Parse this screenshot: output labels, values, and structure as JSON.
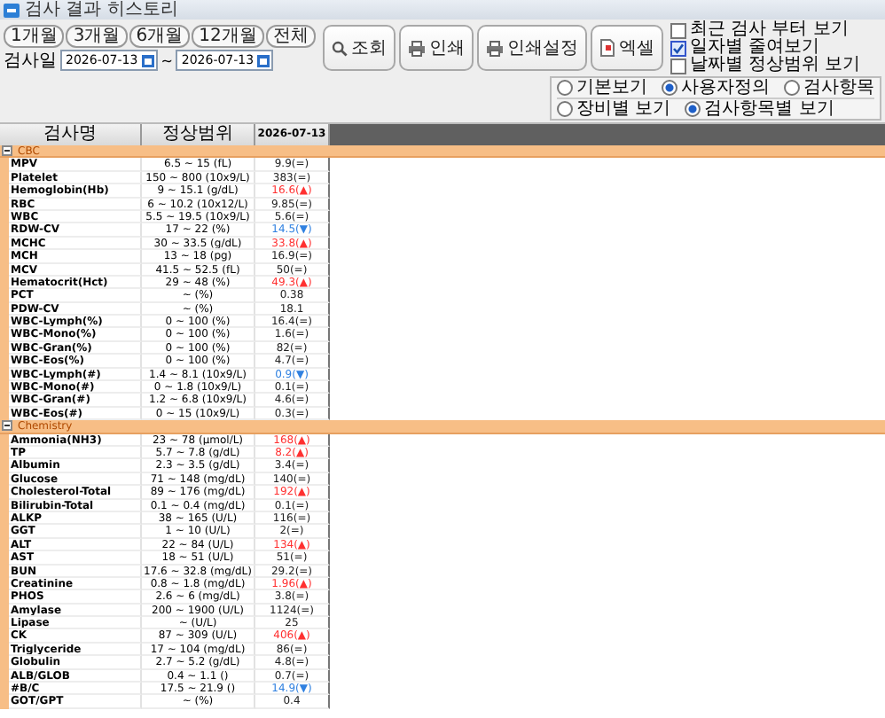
{
  "window": {
    "title": "검사 결과 히스토리"
  },
  "periods": [
    "1개월",
    "3개월",
    "6개월",
    "12개월",
    "전체"
  ],
  "date_filter": {
    "label": "검사일",
    "from": "2026-07-13",
    "separator": "~",
    "to": "2026-07-13"
  },
  "actions": [
    {
      "kind": "search",
      "label": "조회"
    },
    {
      "kind": "print",
      "label": "인쇄"
    },
    {
      "kind": "print",
      "label": "인쇄설정"
    },
    {
      "kind": "excel",
      "label": "엑셀"
    }
  ],
  "options": [
    {
      "label": "최근 검사 부터 보기",
      "checked": false
    },
    {
      "label": "일자별 줄여보기",
      "checked": true
    },
    {
      "label": "날짜별 정상범위 보기",
      "checked": false
    }
  ],
  "view_modes": [
    [
      {
        "label": "기본보기",
        "selected": false
      },
      {
        "label": "사용자정의",
        "selected": true
      },
      {
        "label": "검사항목",
        "selected": false
      }
    ],
    [
      {
        "label": "장비별 보기",
        "selected": false
      },
      {
        "label": "검사항목별 보기",
        "selected": true
      }
    ]
  ],
  "table": {
    "columns": [
      "검사명",
      "정상범위",
      "2026-07-13"
    ],
    "groups": [
      {
        "name": "CBC",
        "expanded": true,
        "rows": [
          {
            "name": "MPV",
            "range": "6.5 ~ 15 (fL)",
            "value": "9.9(=)",
            "high": false,
            "low": false
          },
          {
            "name": "Platelet",
            "range": "150 ~ 800 (10x9/L)",
            "value": "383(=)",
            "high": false,
            "low": false
          },
          {
            "name": "Hemoglobin(Hb)",
            "range": "9 ~ 15.1 (g/dL)",
            "value": "16.6(▲)",
            "high": true,
            "low": false
          },
          {
            "name": "RBC",
            "range": "6 ~ 10.2 (10x12/L)",
            "value": "9.85(=)",
            "high": false,
            "low": false
          },
          {
            "name": "WBC",
            "range": "5.5 ~ 19.5 (10x9/L)",
            "value": "5.6(=)",
            "high": false,
            "low": false
          },
          {
            "name": "RDW-CV",
            "range": "17 ~ 22 (%)",
            "value": "14.5(▼)",
            "high": false,
            "low": true
          },
          {
            "name": "MCHC",
            "range": "30 ~ 33.5 (g/dL)",
            "value": "33.8(▲)",
            "high": true,
            "low": false
          },
          {
            "name": "MCH",
            "range": "13 ~ 18 (pg)",
            "value": "16.9(=)",
            "high": false,
            "low": false
          },
          {
            "name": "MCV",
            "range": "41.5 ~ 52.5 (fL)",
            "value": "50(=)",
            "high": false,
            "low": false
          },
          {
            "name": "Hematocrit(Hct)",
            "range": "29 ~ 48 (%)",
            "value": "49.3(▲)",
            "high": true,
            "low": false
          },
          {
            "name": "PCT",
            "range": "~ (%)",
            "value": "0.38",
            "high": false,
            "low": false
          },
          {
            "name": "PDW-CV",
            "range": "~ (%)",
            "value": "18.1",
            "high": false,
            "low": false
          },
          {
            "name": "WBC-Lymph(%)",
            "range": "0 ~ 100 (%)",
            "value": "16.4(=)",
            "high": false,
            "low": false
          },
          {
            "name": "WBC-Mono(%)",
            "range": "0 ~ 100 (%)",
            "value": "1.6(=)",
            "high": false,
            "low": false
          },
          {
            "name": "WBC-Gran(%)",
            "range": "0 ~ 100 (%)",
            "value": "82(=)",
            "high": false,
            "low": false
          },
          {
            "name": "WBC-Eos(%)",
            "range": "0 ~ 100 (%)",
            "value": "4.7(=)",
            "high": false,
            "low": false
          },
          {
            "name": "WBC-Lymph(#)",
            "range": "1.4 ~ 8.1 (10x9/L)",
            "value": "0.9(▼)",
            "high": false,
            "low": true
          },
          {
            "name": "WBC-Mono(#)",
            "range": "0 ~ 1.8 (10x9/L)",
            "value": "0.1(=)",
            "high": false,
            "low": false
          },
          {
            "name": "WBC-Gran(#)",
            "range": "1.2 ~ 6.8 (10x9/L)",
            "value": "4.6(=)",
            "high": false,
            "low": false
          },
          {
            "name": "WBC-Eos(#)",
            "range": "0 ~ 15 (10x9/L)",
            "value": "0.3(=)",
            "high": false,
            "low": false
          }
        ]
      },
      {
        "name": "Chemistry",
        "expanded": true,
        "rows": [
          {
            "name": "Ammonia(NH3)",
            "range": "23 ~ 78 (μmol/L)",
            "value": "168(▲)",
            "high": true,
            "low": false
          },
          {
            "name": "TP",
            "range": "5.7 ~ 7.8 (g/dL)",
            "value": "8.2(▲)",
            "high": true,
            "low": false
          },
          {
            "name": "Albumin",
            "range": "2.3 ~ 3.5 (g/dL)",
            "value": "3.4(=)",
            "high": false,
            "low": false
          },
          {
            "name": "Glucose",
            "range": "71 ~ 148 (mg/dL)",
            "value": "140(=)",
            "high": false,
            "low": false
          },
          {
            "name": "Cholesterol-Total",
            "range": "89 ~ 176 (mg/dL)",
            "value": "192(▲)",
            "high": true,
            "low": false
          },
          {
            "name": "Bilirubin-Total",
            "range": "0.1 ~ 0.4 (mg/dL)",
            "value": "0.1(=)",
            "high": false,
            "low": false
          },
          {
            "name": "ALKP",
            "range": "38 ~ 165 (U/L)",
            "value": "116(=)",
            "high": false,
            "low": false
          },
          {
            "name": "GGT",
            "range": "1 ~ 10 (U/L)",
            "value": "2(=)",
            "high": false,
            "low": false
          },
          {
            "name": "ALT",
            "range": "22 ~ 84 (U/L)",
            "value": "134(▲)",
            "high": true,
            "low": false
          },
          {
            "name": "AST",
            "range": "18 ~ 51 (U/L)",
            "value": "51(=)",
            "high": false,
            "low": false
          },
          {
            "name": "BUN",
            "range": "17.6 ~ 32.8 (mg/dL)",
            "value": "29.2(=)",
            "high": false,
            "low": false
          },
          {
            "name": "Creatinine",
            "range": "0.8 ~ 1.8 (mg/dL)",
            "value": "1.96(▲)",
            "high": true,
            "low": false
          },
          {
            "name": "PHOS",
            "range": "2.6 ~ 6 (mg/dL)",
            "value": "3.8(=)",
            "high": false,
            "low": false
          },
          {
            "name": "Amylase",
            "range": "200 ~ 1900 (U/L)",
            "value": "1124(=)",
            "high": false,
            "low": false
          },
          {
            "name": "Lipase",
            "range": "~ (U/L)",
            "value": "25",
            "high": false,
            "low": false
          },
          {
            "name": "CK",
            "range": "87 ~ 309 (U/L)",
            "value": "406(▲)",
            "high": true,
            "low": false
          },
          {
            "name": "Triglyceride",
            "range": "17 ~ 104 (mg/dL)",
            "value": "86(=)",
            "high": false,
            "low": false
          },
          {
            "name": "Globulin",
            "range": "2.7 ~ 5.2 (g/dL)",
            "value": "4.8(=)",
            "high": false,
            "low": false
          },
          {
            "name": "ALB/GLOB",
            "range": "0.4 ~ 1.1 ()",
            "value": "0.7(=)",
            "high": false,
            "low": false
          },
          {
            "name": "#B/C",
            "range": "17.5 ~ 21.9 ()",
            "value": "14.9(▼)",
            "high": false,
            "low": true
          },
          {
            "name": "GOT/GPT",
            "range": "~ (%)",
            "value": "0.4",
            "high": false,
            "low": false
          }
        ]
      }
    ]
  }
}
